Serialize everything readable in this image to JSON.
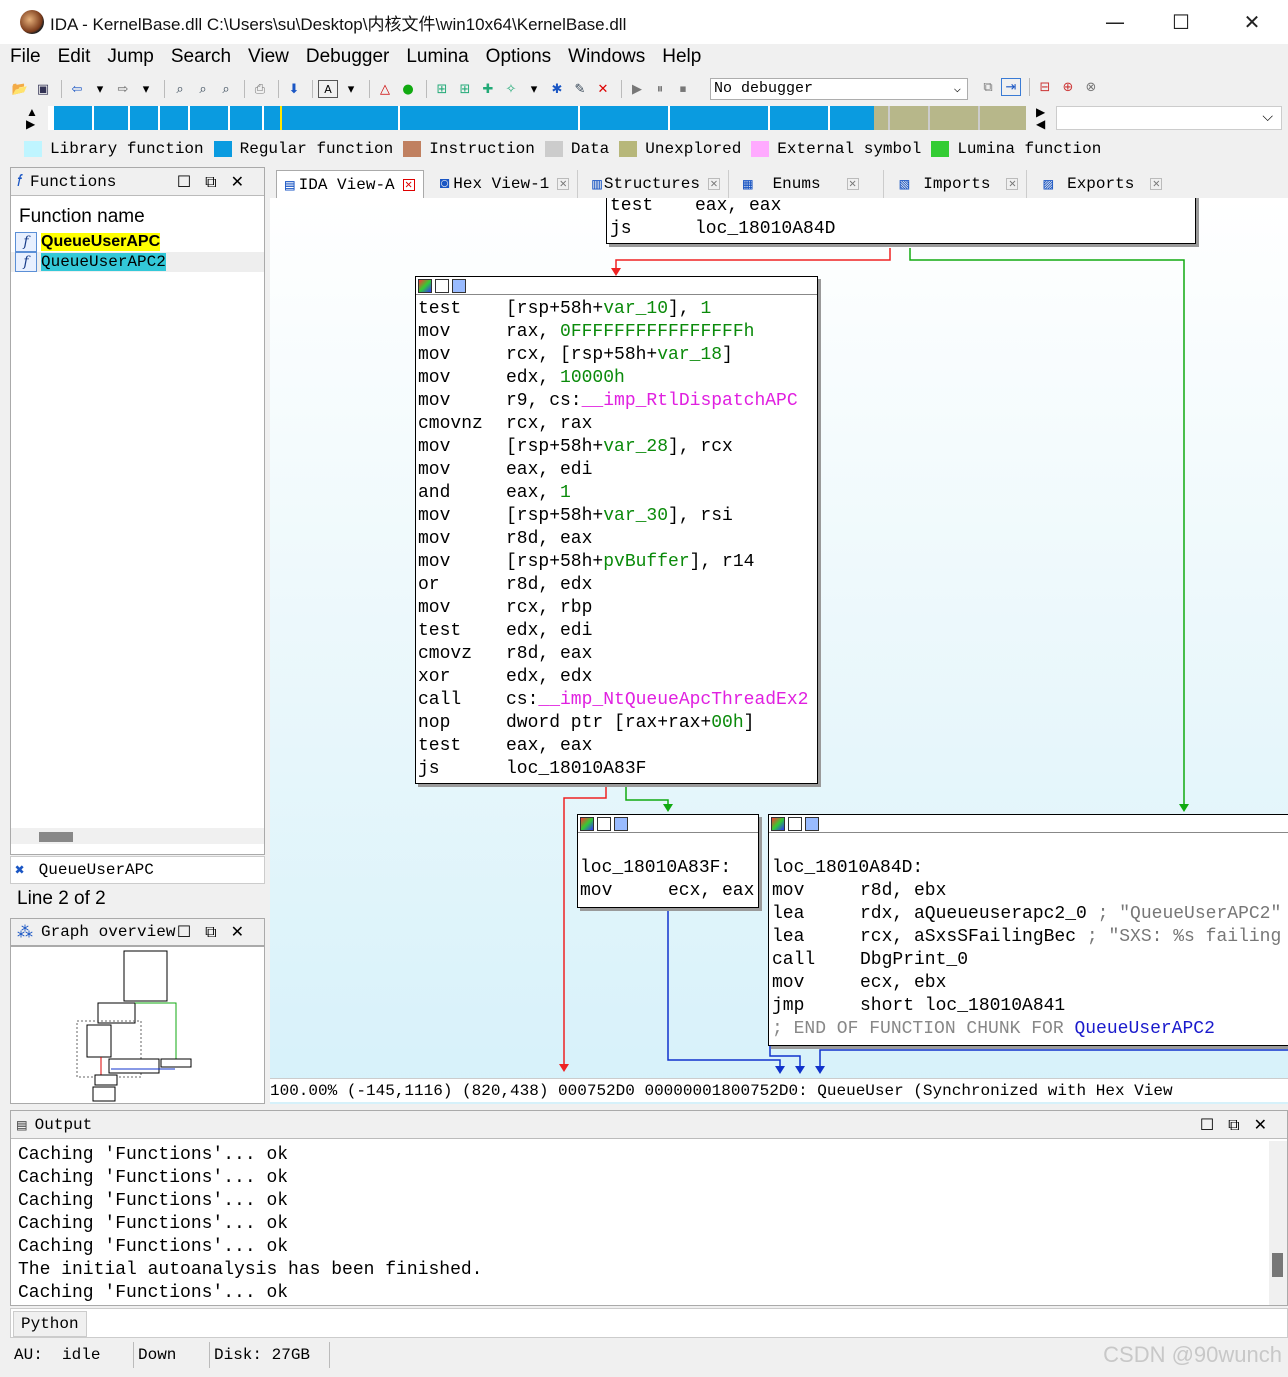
{
  "window": {
    "title": "IDA - KernelBase.dll C:\\Users\\su\\Desktop\\内核文件\\win10x64\\KernelBase.dll",
    "minimize": "—",
    "maximize": "☐",
    "close": "✕"
  },
  "menu": [
    "File",
    "Edit",
    "Jump",
    "Search",
    "View",
    "Debugger",
    "Lumina",
    "Options",
    "Windows",
    "Help"
  ],
  "toolbar": {
    "debugger_select": "No debugger"
  },
  "legend": [
    {
      "label": "Library function",
      "color": "#bff5ff"
    },
    {
      "label": "Regular function",
      "color": "#0a9be0"
    },
    {
      "label": "Instruction",
      "color": "#c08060"
    },
    {
      "label": "Data",
      "color": "#cccccc"
    },
    {
      "label": "Unexplored",
      "color": "#b7b77a"
    },
    {
      "label": "External symbol",
      "color": "#ffaaff"
    },
    {
      "label": "Lumina function",
      "color": "#33cc33"
    }
  ],
  "functions_panel": {
    "title": "Functions",
    "column": "Function name",
    "items": [
      "QueueUserAPC",
      "QueueUserAPC2"
    ],
    "filter_text": "QueueUserAPC",
    "line_info": "Line 2 of 2"
  },
  "graph_overview": {
    "title": "Graph overview"
  },
  "tabs": [
    {
      "label": "IDA View-A"
    },
    {
      "label": "Hex View-1"
    },
    {
      "label": "Structures"
    },
    {
      "label": "Enums"
    },
    {
      "label": "Imports"
    },
    {
      "label": "Exports"
    }
  ],
  "graph": {
    "top_block": [
      [
        "test",
        "eax, eax"
      ],
      [
        "js",
        "loc_18010A84D"
      ]
    ],
    "main_block": [
      [
        "test",
        "[rsp+58h+var_10], 1"
      ],
      [
        "mov",
        "rax, 0FFFFFFFFFFFFFFFFh"
      ],
      [
        "mov",
        "rcx, [rsp+58h+var_18]"
      ],
      [
        "mov",
        "edx, 10000h"
      ],
      [
        "mov",
        "r9, cs:__imp_RtlDispatchAPC"
      ],
      [
        "cmovnz",
        "rcx, rax"
      ],
      [
        "mov",
        "[rsp+58h+var_28], rcx"
      ],
      [
        "mov",
        "eax, edi"
      ],
      [
        "and",
        "eax, 1"
      ],
      [
        "mov",
        "[rsp+58h+var_30], rsi"
      ],
      [
        "mov",
        "r8d, eax"
      ],
      [
        "mov",
        "[rsp+58h+pvBuffer], r14"
      ],
      [
        "or",
        "r8d, edx"
      ],
      [
        "mov",
        "rcx, rbp"
      ],
      [
        "test",
        "edx, edi"
      ],
      [
        "cmovz",
        "r8d, eax"
      ],
      [
        "xor",
        "edx, edx"
      ],
      [
        "call",
        "cs:__imp_NtQueueApcThreadEx2"
      ],
      [
        "nop",
        "dword ptr [rax+rax+00h]"
      ],
      [
        "test",
        "eax, eax"
      ],
      [
        "js",
        "loc_18010A83F"
      ]
    ],
    "left_block": {
      "label": "loc_18010A83F:",
      "lines": [
        [
          "mov",
          "ecx, eax"
        ]
      ]
    },
    "right_block": {
      "label": "loc_18010A84D:",
      "lines": [
        [
          "mov",
          "r8d, ebx"
        ],
        [
          "lea",
          "rdx, aQueueuserapc2_0 ; \"QueueUserAPC2\""
        ],
        [
          "lea",
          "rcx, aSxsSFailingBec ; \"SXS: %s failing"
        ],
        [
          "call",
          "DbgPrint_0"
        ],
        [
          "mov",
          "ecx, ebx"
        ],
        [
          "jmp",
          "short loc_18010A841"
        ]
      ],
      "footer": "; END OF FUNCTION CHUNK FOR QueueUserAPC2"
    },
    "status_line": "100.00% (-145,1116) (820,438) 000752D0 00000001800752D0: QueueUser (Synchronized with Hex View"
  },
  "output": {
    "title": "Output",
    "lines": [
      "Caching 'Functions'... ok",
      "Caching 'Functions'... ok",
      "Caching 'Functions'... ok",
      "Caching 'Functions'... ok",
      "Caching 'Functions'... ok",
      "The initial autoanalysis has been finished.",
      "Caching 'Functions'... ok"
    ],
    "python_button": "Python"
  },
  "statusbar": {
    "au": "AU:  idle",
    "dir": "Down",
    "disk": "Disk: 27GB"
  },
  "watermark": "CSDN @90wunch"
}
